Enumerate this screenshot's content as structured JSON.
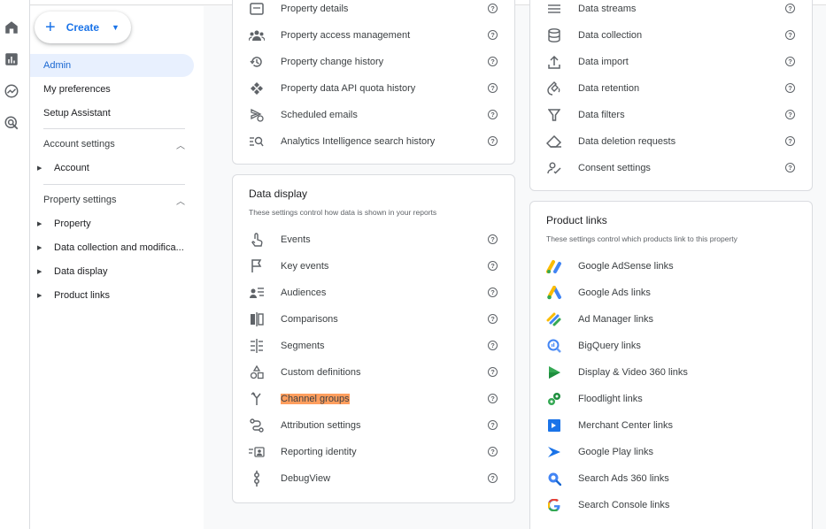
{
  "nav": {
    "create_label": "Create",
    "admin": "Admin",
    "my_preferences": "My preferences",
    "setup_assistant": "Setup Assistant",
    "account_settings": "Account settings",
    "account": "Account",
    "property_settings": "Property settings",
    "property": "Property",
    "data_collection": "Data collection and modifica...",
    "data_display": "Data display",
    "product_links": "Product links"
  },
  "property_card": {
    "items": [
      "Property details",
      "Property access management",
      "Property change history",
      "Property data API quota history",
      "Scheduled emails",
      "Analytics Intelligence search history"
    ]
  },
  "data_display": {
    "title": "Data display",
    "subtitle": "These settings control how data is shown in your reports",
    "items": [
      "Events",
      "Key events",
      "Audiences",
      "Comparisons",
      "Segments",
      "Custom definitions",
      "Channel groups",
      "Attribution settings",
      "Reporting identity",
      "DebugView"
    ]
  },
  "data_collection": {
    "items": [
      "Data streams",
      "Data collection",
      "Data import",
      "Data retention",
      "Data filters",
      "Data deletion requests",
      "Consent settings"
    ]
  },
  "product_links": {
    "title": "Product links",
    "subtitle": "These settings control which products link to this property",
    "items": [
      "Google AdSense links",
      "Google Ads links",
      "Ad Manager links",
      "BigQuery links",
      "Display & Video 360 links",
      "Floodlight links",
      "Merchant Center links",
      "Google Play links",
      "Search Ads 360 links",
      "Search Console links"
    ]
  },
  "colors": {
    "accent": "#1a73e8",
    "active_bg": "#e8f0fe",
    "highlight": "#ff9e5e"
  }
}
